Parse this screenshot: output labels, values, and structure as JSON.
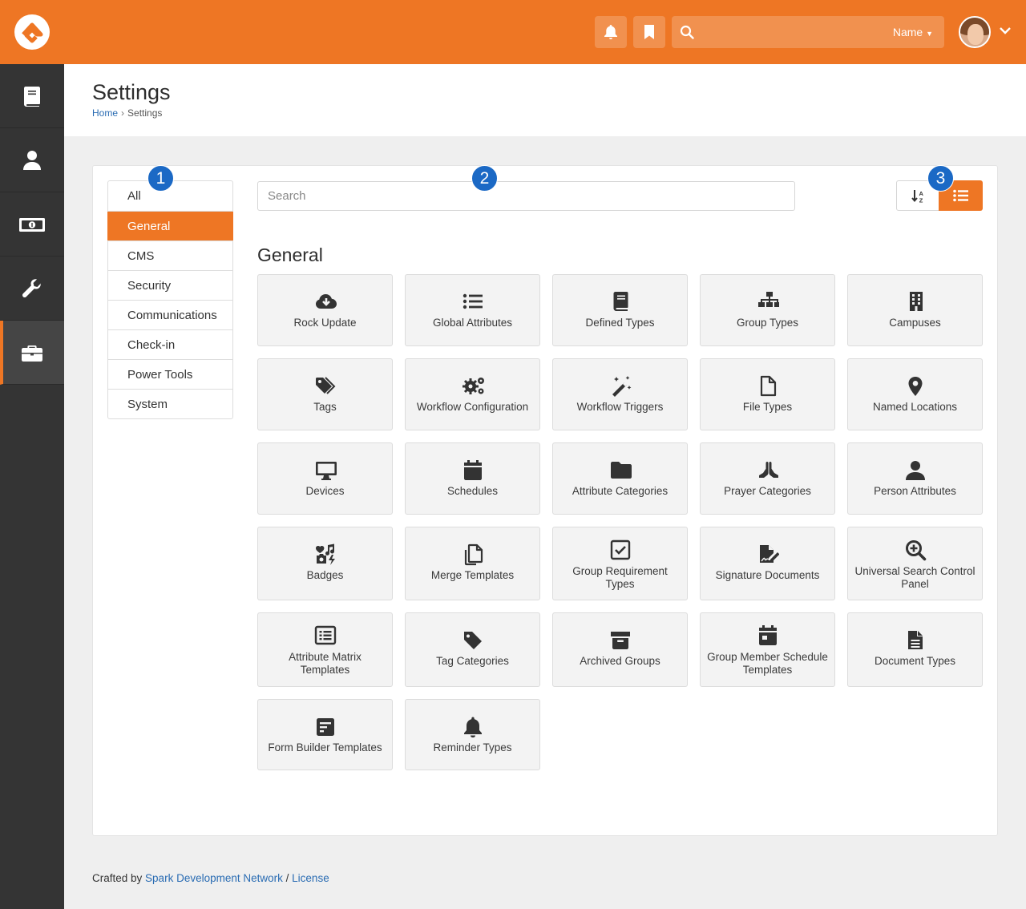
{
  "topbar": {
    "search_filter": "Name",
    "colors": {
      "brand": "#ee7624"
    }
  },
  "sidebar": {
    "items": [
      {
        "icon": "book-icon"
      },
      {
        "icon": "person-icon"
      },
      {
        "icon": "money-icon"
      },
      {
        "icon": "wrench-icon"
      },
      {
        "icon": "briefcase-icon",
        "active": true
      }
    ]
  },
  "header": {
    "title": "Settings",
    "breadcrumb": {
      "home": "Home",
      "current": "Settings"
    }
  },
  "categories": [
    "All",
    "General",
    "CMS",
    "Security",
    "Communications",
    "Check-in",
    "Power Tools",
    "System"
  ],
  "selected_category": "General",
  "search": {
    "placeholder": "Search",
    "value": ""
  },
  "section": {
    "title": "General"
  },
  "tiles": [
    {
      "label": "Rock Update",
      "icon": "cloud-download-icon"
    },
    {
      "label": "Global Attributes",
      "icon": "list-icon"
    },
    {
      "label": "Defined Types",
      "icon": "book-icon"
    },
    {
      "label": "Group Types",
      "icon": "sitemap-icon"
    },
    {
      "label": "Campuses",
      "icon": "building-icon"
    },
    {
      "label": "Tags",
      "icon": "tags-icon"
    },
    {
      "label": "Workflow Configuration",
      "icon": "cogs-icon"
    },
    {
      "label": "Workflow Triggers",
      "icon": "magic-icon"
    },
    {
      "label": "File Types",
      "icon": "file-icon"
    },
    {
      "label": "Named Locations",
      "icon": "map-marker-icon"
    },
    {
      "label": "Devices",
      "icon": "desktop-icon"
    },
    {
      "label": "Schedules",
      "icon": "calendar-icon"
    },
    {
      "label": "Attribute Categories",
      "icon": "folder-icon"
    },
    {
      "label": "Prayer Categories",
      "icon": "praying-hands-icon"
    },
    {
      "label": "Person Attributes",
      "icon": "user-icon"
    },
    {
      "label": "Badges",
      "icon": "icons-icon"
    },
    {
      "label": "Merge Templates",
      "icon": "copy-icon"
    },
    {
      "label": "Group Requirement Types",
      "icon": "check-square-icon"
    },
    {
      "label": "Signature Documents",
      "icon": "file-signature-icon"
    },
    {
      "label": "Universal Search Control Panel",
      "icon": "search-plus-icon"
    },
    {
      "label": "Attribute Matrix Templates",
      "icon": "list-alt-icon"
    },
    {
      "label": "Tag Categories",
      "icon": "tag-icon"
    },
    {
      "label": "Archived Groups",
      "icon": "archive-icon"
    },
    {
      "label": "Group Member Schedule Templates",
      "icon": "calendar-alt-icon"
    },
    {
      "label": "Document Types",
      "icon": "file-alt-icon"
    },
    {
      "label": "Form Builder Templates",
      "icon": "form-icon"
    },
    {
      "label": "Reminder Types",
      "icon": "bell-icon"
    }
  ],
  "callouts": [
    "1",
    "2",
    "3"
  ],
  "footer": {
    "prefix": "Crafted by",
    "org": "Spark Development Network",
    "sep": "/",
    "license": "License"
  }
}
